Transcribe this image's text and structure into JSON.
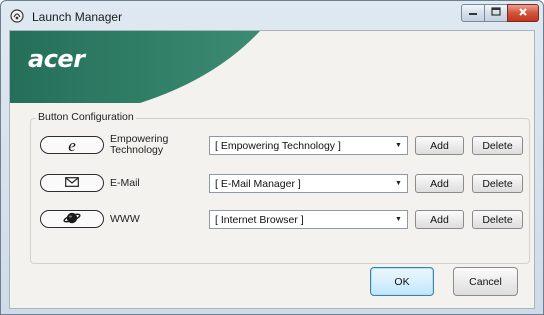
{
  "window": {
    "title": "Launch Manager",
    "controls": {
      "minimize": "minimize-icon",
      "maximize": "maximize-icon",
      "close": "close-icon"
    }
  },
  "banner": {
    "logo": "acer",
    "color": "#2c7a62"
  },
  "button_configuration": {
    "label": "Button Configuration",
    "rows": [
      {
        "key_icon": "internet-explorer-e-icon",
        "key_glyph": "e",
        "label_line1": "Empowering",
        "label_line2": "Technology",
        "selected": "[ Empowering Technology ]",
        "add": "Add",
        "delete": "Delete"
      },
      {
        "key_icon": "envelope-icon",
        "key_glyph": "✉",
        "label_line1": "E-Mail",
        "selected": "[ E-Mail Manager ]",
        "add": "Add",
        "delete": "Delete"
      },
      {
        "key_icon": "globe-icon",
        "label_line1": "WWW",
        "selected": "[ Internet Browser ]",
        "add": "Add",
        "delete": "Delete"
      }
    ]
  },
  "footer": {
    "ok": "OK",
    "cancel": "Cancel"
  }
}
